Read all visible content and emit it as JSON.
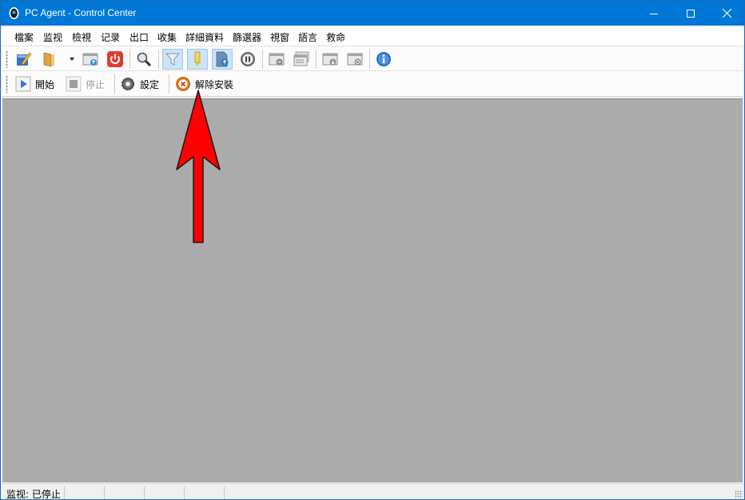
{
  "window": {
    "title": "PC Agent - Control Center",
    "accent_color": "#0078d7",
    "controls": [
      "minimize-icon",
      "maximize-icon",
      "close-icon"
    ]
  },
  "menu": {
    "items": [
      "檔案",
      "监视",
      "檢視",
      "记录",
      "出口",
      "收集",
      "詳細資料",
      "篩選器",
      "視窗",
      "語言",
      "救命"
    ]
  },
  "toolbar_main": {
    "buttons": [
      {
        "icon": "edit-notebook-icon"
      },
      {
        "icon": "open-folder-icon"
      },
      {
        "icon": "dropdown-arrow-icon"
      },
      {
        "icon": "export-window-icon"
      },
      {
        "icon": "power-icon"
      },
      {
        "icon": "search-magnifier-icon"
      },
      {
        "icon": "filter-funnel-icon",
        "checked": true
      },
      {
        "icon": "highlight-marker-icon",
        "checked": true
      },
      {
        "icon": "document-upload-icon",
        "checked": true
      },
      {
        "icon": "pause-circle-icon"
      },
      {
        "icon": "window-minus-icon"
      },
      {
        "icon": "window-list-icon"
      },
      {
        "icon": "window-download-icon"
      },
      {
        "icon": "window-refresh-icon"
      },
      {
        "icon": "info-icon"
      }
    ]
  },
  "toolbar_agent": {
    "start_label": "開始",
    "stop_label": "停止",
    "settings_label": "設定",
    "uninstall_label": "解除安裝"
  },
  "annotation": {
    "arrow_color": "#ff0000",
    "icon": "red-arrow-up-icon"
  },
  "statusbar": {
    "status_text": "监视: 已停止"
  }
}
